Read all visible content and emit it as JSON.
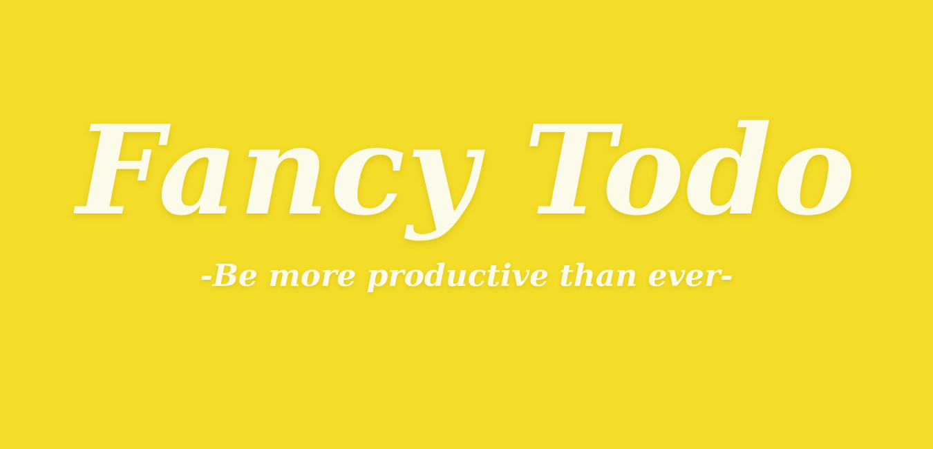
{
  "hero": {
    "title": "Fancy Todo",
    "tagline": "-Be more productive than ever-"
  },
  "colors": {
    "background": "#f4dd29",
    "text": "#fcfae8"
  }
}
